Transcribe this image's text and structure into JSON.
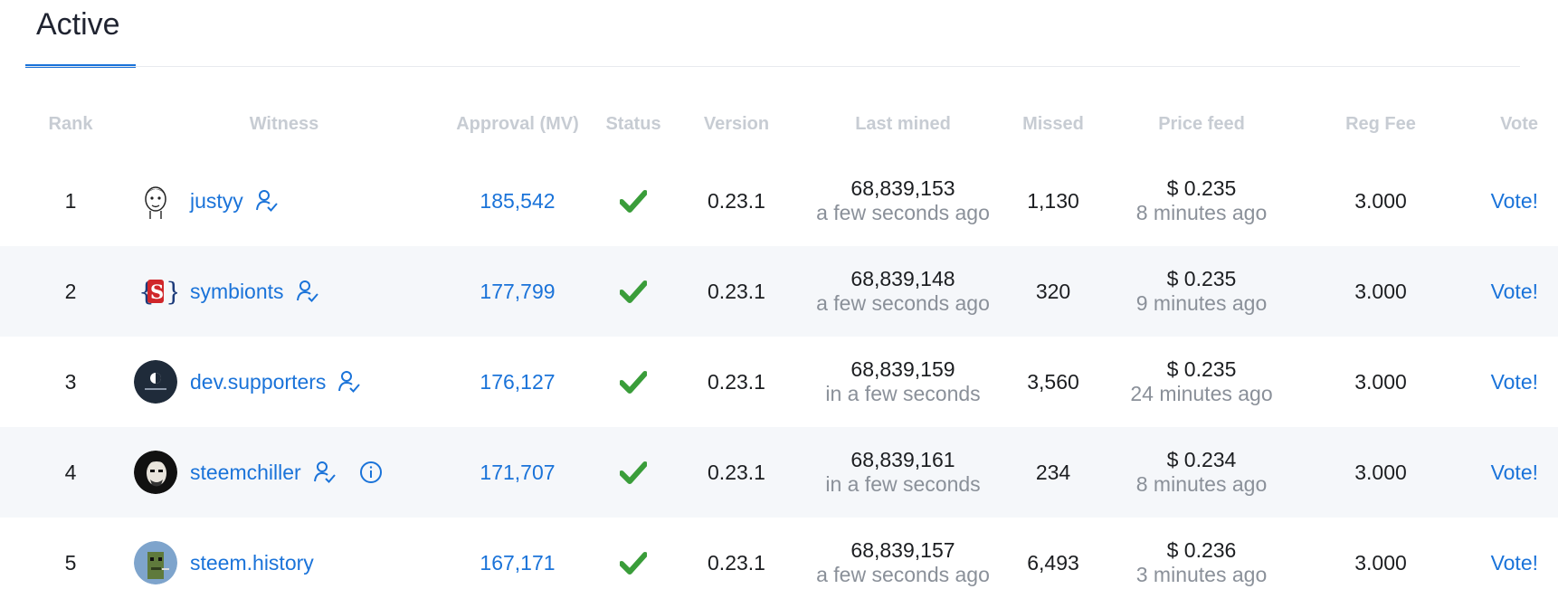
{
  "tabs": {
    "active_label": "Active"
  },
  "columns": {
    "rank": "Rank",
    "witness": "Witness",
    "approval": "Approval (MV)",
    "status": "Status",
    "version": "Version",
    "last_mined": "Last mined",
    "missed": "Missed",
    "price_feed": "Price feed",
    "reg_fee": "Reg Fee",
    "vote": "Vote"
  },
  "colors": {
    "accent": "#1a73d9",
    "check": "#3a9d3a",
    "muted": "#8a9099",
    "alt_row": "#f5f7fa"
  },
  "rows": [
    {
      "rank": "1",
      "witness": "justyy",
      "approval": "185,542",
      "status": "check-icon",
      "version": "0.23.1",
      "last_block": "68,839,153",
      "last_time": "a few seconds ago",
      "missed": "1,130",
      "price": "$ 0.235",
      "price_time": "8 minutes ago",
      "fee": "3.000",
      "vote": "Vote!"
    },
    {
      "rank": "2",
      "witness": "symbionts",
      "approval": "177,799",
      "status": "check-icon",
      "version": "0.23.1",
      "last_block": "68,839,148",
      "last_time": "a few seconds ago",
      "missed": "320",
      "price": "$ 0.235",
      "price_time": "9 minutes ago",
      "fee": "3.000",
      "vote": "Vote!"
    },
    {
      "rank": "3",
      "witness": "dev.supporters",
      "approval": "176,127",
      "status": "check-icon",
      "version": "0.23.1",
      "last_block": "68,839,159",
      "last_time": "in a few seconds",
      "missed": "3,560",
      "price": "$ 0.235",
      "price_time": "24 minutes ago",
      "fee": "3.000",
      "vote": "Vote!"
    },
    {
      "rank": "4",
      "witness": "steemchiller",
      "approval": "171,707",
      "status": "check-icon",
      "version": "0.23.1",
      "last_block": "68,839,161",
      "last_time": "in a few seconds",
      "missed": "234",
      "price": "$ 0.234",
      "price_time": "8 minutes ago",
      "fee": "3.000",
      "vote": "Vote!"
    },
    {
      "rank": "5",
      "witness": "steem.history",
      "approval": "167,171",
      "status": "check-icon",
      "version": "0.23.1",
      "last_block": "68,839,157",
      "last_time": "a few seconds ago",
      "missed": "6,493",
      "price": "$ 0.236",
      "price_time": "3 minutes ago",
      "fee": "3.000",
      "vote": "Vote!"
    }
  ]
}
